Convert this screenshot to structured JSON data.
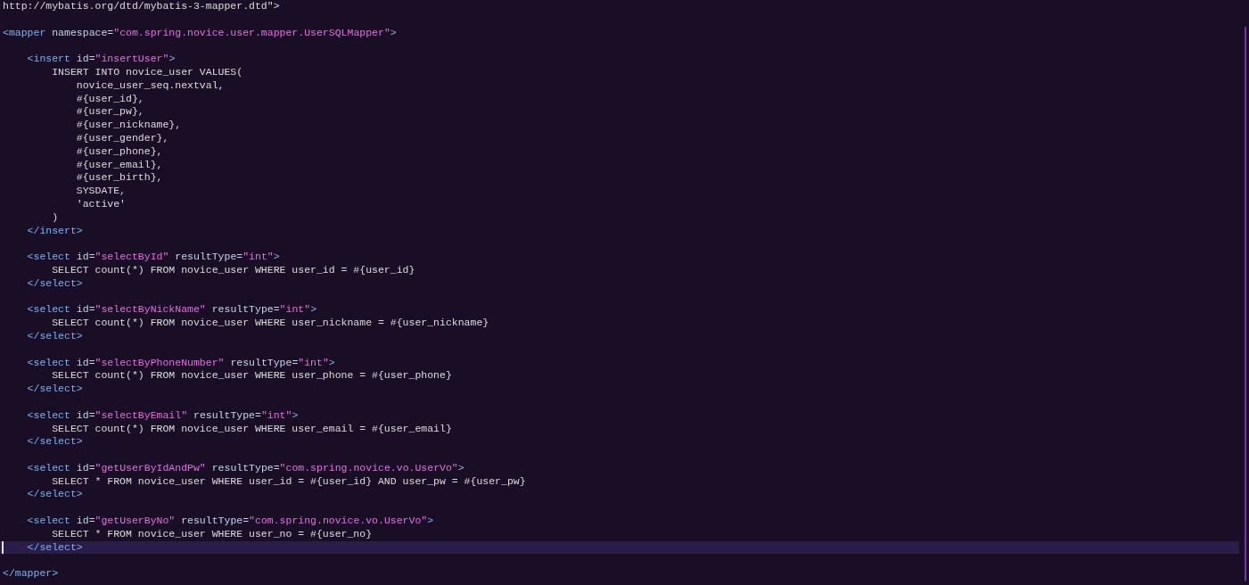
{
  "editor": {
    "lines": [
      {
        "current": false,
        "tokens": [
          {
            "kind": "text",
            "text": "http://mybatis.org/dtd/mybatis-3-mapper.dtd\">"
          }
        ]
      },
      {
        "current": false
      },
      {
        "current": false,
        "tokens": [
          {
            "kind": "tag",
            "text": "<mapper "
          },
          {
            "kind": "attr",
            "text": "namespace="
          },
          {
            "kind": "string",
            "text": "\"com.spring.novice.user.mapper.UserSQLMapper\""
          },
          {
            "kind": "tag",
            "text": ">"
          }
        ]
      },
      {
        "current": false
      },
      {
        "current": false,
        "tokens": [
          {
            "kind": "tag",
            "text": "    <insert "
          },
          {
            "kind": "attr",
            "text": "id="
          },
          {
            "kind": "string",
            "text": "\"insertUser\""
          },
          {
            "kind": "tag",
            "text": ">"
          }
        ]
      },
      {
        "current": false,
        "tokens": [
          {
            "kind": "text",
            "text": "        INSERT INTO novice_user VALUES("
          }
        ]
      },
      {
        "current": false,
        "tokens": [
          {
            "kind": "text",
            "text": "            novice_user_seq.nextval,"
          }
        ]
      },
      {
        "current": false,
        "tokens": [
          {
            "kind": "text",
            "text": "            #{user_id},"
          }
        ]
      },
      {
        "current": false,
        "tokens": [
          {
            "kind": "text",
            "text": "            #{user_pw},"
          }
        ]
      },
      {
        "current": false,
        "tokens": [
          {
            "kind": "text",
            "text": "            #{user_nickname},"
          }
        ]
      },
      {
        "current": false,
        "tokens": [
          {
            "kind": "text",
            "text": "            #{user_gender},"
          }
        ]
      },
      {
        "current": false,
        "tokens": [
          {
            "kind": "text",
            "text": "            #{user_phone},"
          }
        ]
      },
      {
        "current": false,
        "tokens": [
          {
            "kind": "text",
            "text": "            #{user_email},"
          }
        ]
      },
      {
        "current": false,
        "tokens": [
          {
            "kind": "text",
            "text": "            #{user_birth},"
          }
        ]
      },
      {
        "current": false,
        "tokens": [
          {
            "kind": "text",
            "text": "            SYSDATE,"
          }
        ]
      },
      {
        "current": false,
        "tokens": [
          {
            "kind": "text",
            "text": "            'active'"
          }
        ]
      },
      {
        "current": false,
        "tokens": [
          {
            "kind": "text",
            "text": "        )"
          }
        ]
      },
      {
        "current": false,
        "tokens": [
          {
            "kind": "tag",
            "text": "    </insert>"
          }
        ]
      },
      {
        "current": false
      },
      {
        "current": false,
        "tokens": [
          {
            "kind": "tag",
            "text": "    <select "
          },
          {
            "kind": "attr",
            "text": "id="
          },
          {
            "kind": "string",
            "text": "\"selectById\""
          },
          {
            "kind": "attr",
            "text": " resultType="
          },
          {
            "kind": "string",
            "text": "\"int\""
          },
          {
            "kind": "tag",
            "text": ">"
          }
        ]
      },
      {
        "current": false,
        "tokens": [
          {
            "kind": "text",
            "text": "        SELECT count(*) FROM novice_user WHERE user_id = #{user_id}"
          }
        ]
      },
      {
        "current": false,
        "tokens": [
          {
            "kind": "tag",
            "text": "    </select>"
          }
        ]
      },
      {
        "current": false
      },
      {
        "current": false,
        "tokens": [
          {
            "kind": "tag",
            "text": "    <select "
          },
          {
            "kind": "attr",
            "text": "id="
          },
          {
            "kind": "string",
            "text": "\"selectByNickName\""
          },
          {
            "kind": "attr",
            "text": " resultType="
          },
          {
            "kind": "string",
            "text": "\"int\""
          },
          {
            "kind": "tag",
            "text": ">"
          }
        ]
      },
      {
        "current": false,
        "tokens": [
          {
            "kind": "text",
            "text": "        SELECT count(*) FROM novice_user WHERE user_nickname = #{user_nickname}"
          }
        ]
      },
      {
        "current": false,
        "tokens": [
          {
            "kind": "tag",
            "text": "    </select>"
          }
        ]
      },
      {
        "current": false
      },
      {
        "current": false,
        "tokens": [
          {
            "kind": "tag",
            "text": "    <select "
          },
          {
            "kind": "attr",
            "text": "id="
          },
          {
            "kind": "string",
            "text": "\"selectByPhoneNumber\""
          },
          {
            "kind": "attr",
            "text": " resultType="
          },
          {
            "kind": "string",
            "text": "\"int\""
          },
          {
            "kind": "tag",
            "text": ">"
          }
        ]
      },
      {
        "current": false,
        "tokens": [
          {
            "kind": "text",
            "text": "        SELECT count(*) FROM novice_user WHERE user_phone = #{user_phone}"
          }
        ]
      },
      {
        "current": false,
        "tokens": [
          {
            "kind": "tag",
            "text": "    </select>"
          }
        ]
      },
      {
        "current": false
      },
      {
        "current": false,
        "tokens": [
          {
            "kind": "tag",
            "text": "    <select "
          },
          {
            "kind": "attr",
            "text": "id="
          },
          {
            "kind": "string",
            "text": "\"selectByEmail\""
          },
          {
            "kind": "attr",
            "text": " resultType="
          },
          {
            "kind": "string",
            "text": "\"int\""
          },
          {
            "kind": "tag",
            "text": ">"
          }
        ]
      },
      {
        "current": false,
        "tokens": [
          {
            "kind": "text",
            "text": "        SELECT count(*) FROM novice_user WHERE user_email = #{user_email}"
          }
        ]
      },
      {
        "current": false,
        "tokens": [
          {
            "kind": "tag",
            "text": "    </select>"
          }
        ]
      },
      {
        "current": false
      },
      {
        "current": false,
        "tokens": [
          {
            "kind": "tag",
            "text": "    <select "
          },
          {
            "kind": "attr",
            "text": "id="
          },
          {
            "kind": "string",
            "text": "\"getUserByIdAndPw\""
          },
          {
            "kind": "attr",
            "text": " resultType="
          },
          {
            "kind": "string",
            "text": "\"com.spring.novice.vo.UserVo\""
          },
          {
            "kind": "tag",
            "text": ">"
          }
        ]
      },
      {
        "current": false,
        "tokens": [
          {
            "kind": "text",
            "text": "        SELECT * FROM novice_user WHERE user_id = #{user_id} AND user_pw = #{user_pw}"
          }
        ]
      },
      {
        "current": false,
        "tokens": [
          {
            "kind": "tag",
            "text": "    </select>"
          }
        ]
      },
      {
        "current": false
      },
      {
        "current": false,
        "tokens": [
          {
            "kind": "tag",
            "text": "    <select "
          },
          {
            "kind": "attr",
            "text": "id="
          },
          {
            "kind": "string",
            "text": "\"getUserByNo\""
          },
          {
            "kind": "attr",
            "text": " resultType="
          },
          {
            "kind": "string",
            "text": "\"com.spring.novice.vo.UserVo\""
          },
          {
            "kind": "tag",
            "text": ">"
          }
        ]
      },
      {
        "current": false,
        "tokens": [
          {
            "kind": "text",
            "text": "        SELECT * FROM novice_user WHERE user_no = #{user_no}"
          }
        ]
      },
      {
        "current": true,
        "tokens": [
          {
            "kind": "tag",
            "text": "    </select>"
          }
        ]
      },
      {
        "current": false
      },
      {
        "current": false,
        "tokens": [
          {
            "kind": "tag",
            "text": "</mapper>"
          }
        ]
      }
    ]
  }
}
